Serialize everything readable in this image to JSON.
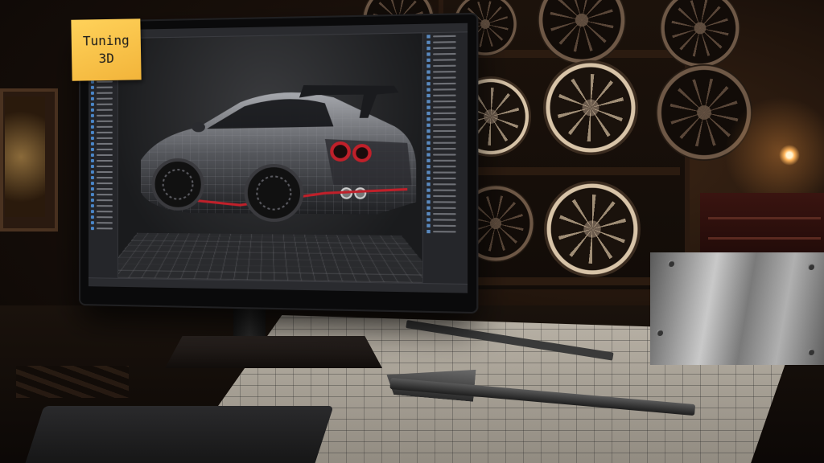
{
  "sticky_note": {
    "line1": "Tuning",
    "line2": "3D"
  },
  "colors": {
    "sticky_note": "#f2b43a",
    "accent_blue": "#4a86c8",
    "car_red_trim": "#c0202a",
    "warm_light": "#ffb45a"
  },
  "icons": {
    "monitor": "monitor-icon",
    "car": "sports-car-icon",
    "wheel": "alloy-wheel-icon",
    "caliper": "vernier-caliper-icon",
    "ruler": "ruler-icon"
  }
}
